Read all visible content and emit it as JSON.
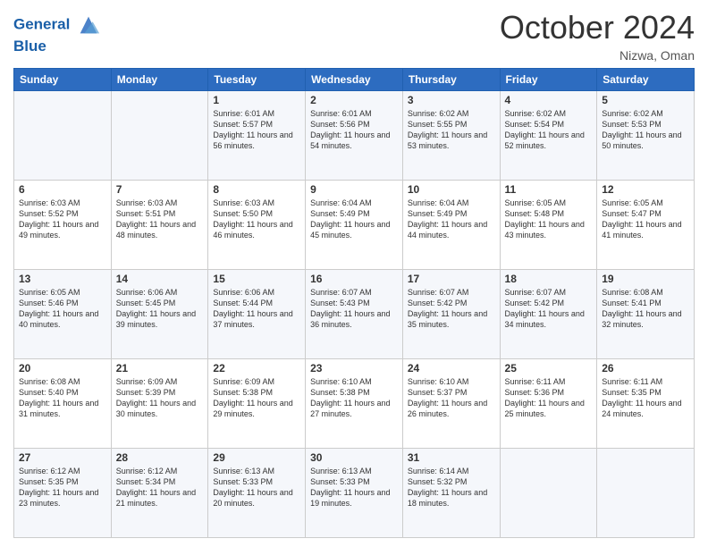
{
  "header": {
    "logo_line1": "General",
    "logo_line2": "Blue",
    "month": "October 2024",
    "location": "Nizwa, Oman"
  },
  "weekdays": [
    "Sunday",
    "Monday",
    "Tuesday",
    "Wednesday",
    "Thursday",
    "Friday",
    "Saturday"
  ],
  "weeks": [
    [
      {
        "day": "",
        "info": ""
      },
      {
        "day": "",
        "info": ""
      },
      {
        "day": "1",
        "info": "Sunrise: 6:01 AM\nSunset: 5:57 PM\nDaylight: 11 hours and 56 minutes."
      },
      {
        "day": "2",
        "info": "Sunrise: 6:01 AM\nSunset: 5:56 PM\nDaylight: 11 hours and 54 minutes."
      },
      {
        "day": "3",
        "info": "Sunrise: 6:02 AM\nSunset: 5:55 PM\nDaylight: 11 hours and 53 minutes."
      },
      {
        "day": "4",
        "info": "Sunrise: 6:02 AM\nSunset: 5:54 PM\nDaylight: 11 hours and 52 minutes."
      },
      {
        "day": "5",
        "info": "Sunrise: 6:02 AM\nSunset: 5:53 PM\nDaylight: 11 hours and 50 minutes."
      }
    ],
    [
      {
        "day": "6",
        "info": "Sunrise: 6:03 AM\nSunset: 5:52 PM\nDaylight: 11 hours and 49 minutes."
      },
      {
        "day": "7",
        "info": "Sunrise: 6:03 AM\nSunset: 5:51 PM\nDaylight: 11 hours and 48 minutes."
      },
      {
        "day": "8",
        "info": "Sunrise: 6:03 AM\nSunset: 5:50 PM\nDaylight: 11 hours and 46 minutes."
      },
      {
        "day": "9",
        "info": "Sunrise: 6:04 AM\nSunset: 5:49 PM\nDaylight: 11 hours and 45 minutes."
      },
      {
        "day": "10",
        "info": "Sunrise: 6:04 AM\nSunset: 5:49 PM\nDaylight: 11 hours and 44 minutes."
      },
      {
        "day": "11",
        "info": "Sunrise: 6:05 AM\nSunset: 5:48 PM\nDaylight: 11 hours and 43 minutes."
      },
      {
        "day": "12",
        "info": "Sunrise: 6:05 AM\nSunset: 5:47 PM\nDaylight: 11 hours and 41 minutes."
      }
    ],
    [
      {
        "day": "13",
        "info": "Sunrise: 6:05 AM\nSunset: 5:46 PM\nDaylight: 11 hours and 40 minutes."
      },
      {
        "day": "14",
        "info": "Sunrise: 6:06 AM\nSunset: 5:45 PM\nDaylight: 11 hours and 39 minutes."
      },
      {
        "day": "15",
        "info": "Sunrise: 6:06 AM\nSunset: 5:44 PM\nDaylight: 11 hours and 37 minutes."
      },
      {
        "day": "16",
        "info": "Sunrise: 6:07 AM\nSunset: 5:43 PM\nDaylight: 11 hours and 36 minutes."
      },
      {
        "day": "17",
        "info": "Sunrise: 6:07 AM\nSunset: 5:42 PM\nDaylight: 11 hours and 35 minutes."
      },
      {
        "day": "18",
        "info": "Sunrise: 6:07 AM\nSunset: 5:42 PM\nDaylight: 11 hours and 34 minutes."
      },
      {
        "day": "19",
        "info": "Sunrise: 6:08 AM\nSunset: 5:41 PM\nDaylight: 11 hours and 32 minutes."
      }
    ],
    [
      {
        "day": "20",
        "info": "Sunrise: 6:08 AM\nSunset: 5:40 PM\nDaylight: 11 hours and 31 minutes."
      },
      {
        "day": "21",
        "info": "Sunrise: 6:09 AM\nSunset: 5:39 PM\nDaylight: 11 hours and 30 minutes."
      },
      {
        "day": "22",
        "info": "Sunrise: 6:09 AM\nSunset: 5:38 PM\nDaylight: 11 hours and 29 minutes."
      },
      {
        "day": "23",
        "info": "Sunrise: 6:10 AM\nSunset: 5:38 PM\nDaylight: 11 hours and 27 minutes."
      },
      {
        "day": "24",
        "info": "Sunrise: 6:10 AM\nSunset: 5:37 PM\nDaylight: 11 hours and 26 minutes."
      },
      {
        "day": "25",
        "info": "Sunrise: 6:11 AM\nSunset: 5:36 PM\nDaylight: 11 hours and 25 minutes."
      },
      {
        "day": "26",
        "info": "Sunrise: 6:11 AM\nSunset: 5:35 PM\nDaylight: 11 hours and 24 minutes."
      }
    ],
    [
      {
        "day": "27",
        "info": "Sunrise: 6:12 AM\nSunset: 5:35 PM\nDaylight: 11 hours and 23 minutes."
      },
      {
        "day": "28",
        "info": "Sunrise: 6:12 AM\nSunset: 5:34 PM\nDaylight: 11 hours and 21 minutes."
      },
      {
        "day": "29",
        "info": "Sunrise: 6:13 AM\nSunset: 5:33 PM\nDaylight: 11 hours and 20 minutes."
      },
      {
        "day": "30",
        "info": "Sunrise: 6:13 AM\nSunset: 5:33 PM\nDaylight: 11 hours and 19 minutes."
      },
      {
        "day": "31",
        "info": "Sunrise: 6:14 AM\nSunset: 5:32 PM\nDaylight: 11 hours and 18 minutes."
      },
      {
        "day": "",
        "info": ""
      },
      {
        "day": "",
        "info": ""
      }
    ]
  ]
}
